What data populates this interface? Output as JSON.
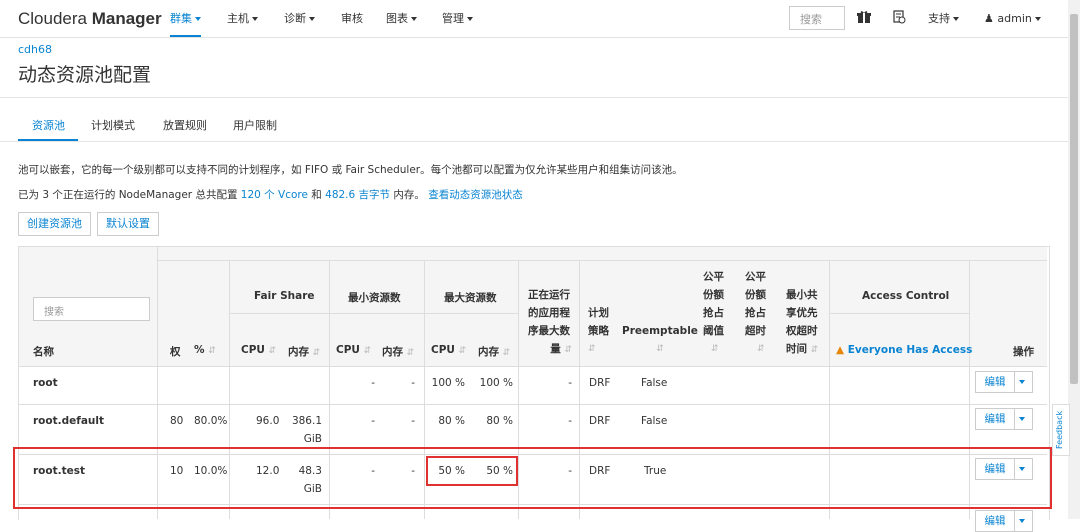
{
  "brand": {
    "name_light": "Cloudera ",
    "name_bold": "Manager"
  },
  "nav": [
    {
      "label": "群集",
      "dropdown": true,
      "active": true
    },
    {
      "label": "主机",
      "dropdown": true
    },
    {
      "label": "诊断",
      "dropdown": true
    },
    {
      "label": "审核",
      "dropdown": false
    },
    {
      "label": "图表",
      "dropdown": true
    },
    {
      "label": "管理",
      "dropdown": true
    }
  ],
  "topright": {
    "search_placeholder": "搜索",
    "support": "支持",
    "user": "admin"
  },
  "breadcrumb": "cdh68",
  "page_title": "动态资源池配置",
  "tabs": [
    "资源池",
    "计划模式",
    "放置规则",
    "用户限制"
  ],
  "desc1": "池可以嵌套，它的每一个级别都可以支持不同的计划程序，如 FIFO 或 Fair Scheduler。每个池都可以配置为仅允许某些用户和组集访问该池。",
  "desc2": {
    "prefix": "已为 3 个正在运行的 NodeManager 总共配置 ",
    "vcore": "120 个 Vcore",
    "mid": " 和 ",
    "mem": "482.6 吉字节",
    "suffix": " 内存。",
    "link": "查看动态资源池状态"
  },
  "buttons": {
    "create": "创建资源池",
    "defaults": "默认设置"
  },
  "table": {
    "filter_placeholder": "搜索",
    "groups": {
      "fair_share": "Fair Share",
      "min": "最小资源数",
      "max": "最大资源数",
      "access": "Access Control"
    },
    "headers": {
      "name": "名称",
      "weight": "权",
      "pct": "%",
      "cpu": "CPU",
      "mem": "内存",
      "running_apps": [
        "正在运行",
        "的应用程",
        "序最大数",
        "量"
      ],
      "policy": [
        "计划",
        "策略"
      ],
      "preemptable": "Preemptable",
      "fair_threshold": [
        "公平",
        "份额",
        "抢占",
        "阈值"
      ],
      "fair_timeout": [
        "公平",
        "份额",
        "抢占",
        "超时"
      ],
      "min_timeout": [
        "最小共",
        "享优先",
        "权超时",
        "时间"
      ],
      "everyone": "Everyone Has Access",
      "actions": "操作"
    },
    "edit_label": "编辑",
    "rows": [
      {
        "name": "root",
        "weight": "",
        "pct": "",
        "fs_cpu": "",
        "fs_mem": "",
        "fs_mem_unit": "",
        "min_cpu": "-",
        "min_mem": "-",
        "max_cpu": "100 %",
        "max_mem": "100 %",
        "apps": "-",
        "policy": "DRF",
        "preempt": "False"
      },
      {
        "name": "root.default",
        "weight": "80",
        "pct": "80.0%",
        "fs_cpu": "96.0",
        "fs_mem": "386.1",
        "fs_mem_unit": "GiB",
        "min_cpu": "-",
        "min_mem": "-",
        "max_cpu": "80 %",
        "max_mem": "80 %",
        "apps": "-",
        "policy": "DRF",
        "preempt": "False"
      },
      {
        "name": "root.test",
        "weight": "10",
        "pct": "10.0%",
        "fs_cpu": "12.0",
        "fs_mem": "48.3",
        "fs_mem_unit": "GiB",
        "min_cpu": "-",
        "min_mem": "-",
        "max_cpu": "50 %",
        "max_mem": "50 %",
        "apps": "-",
        "policy": "DRF",
        "preempt": "True"
      }
    ]
  },
  "feedback": "Feedback"
}
